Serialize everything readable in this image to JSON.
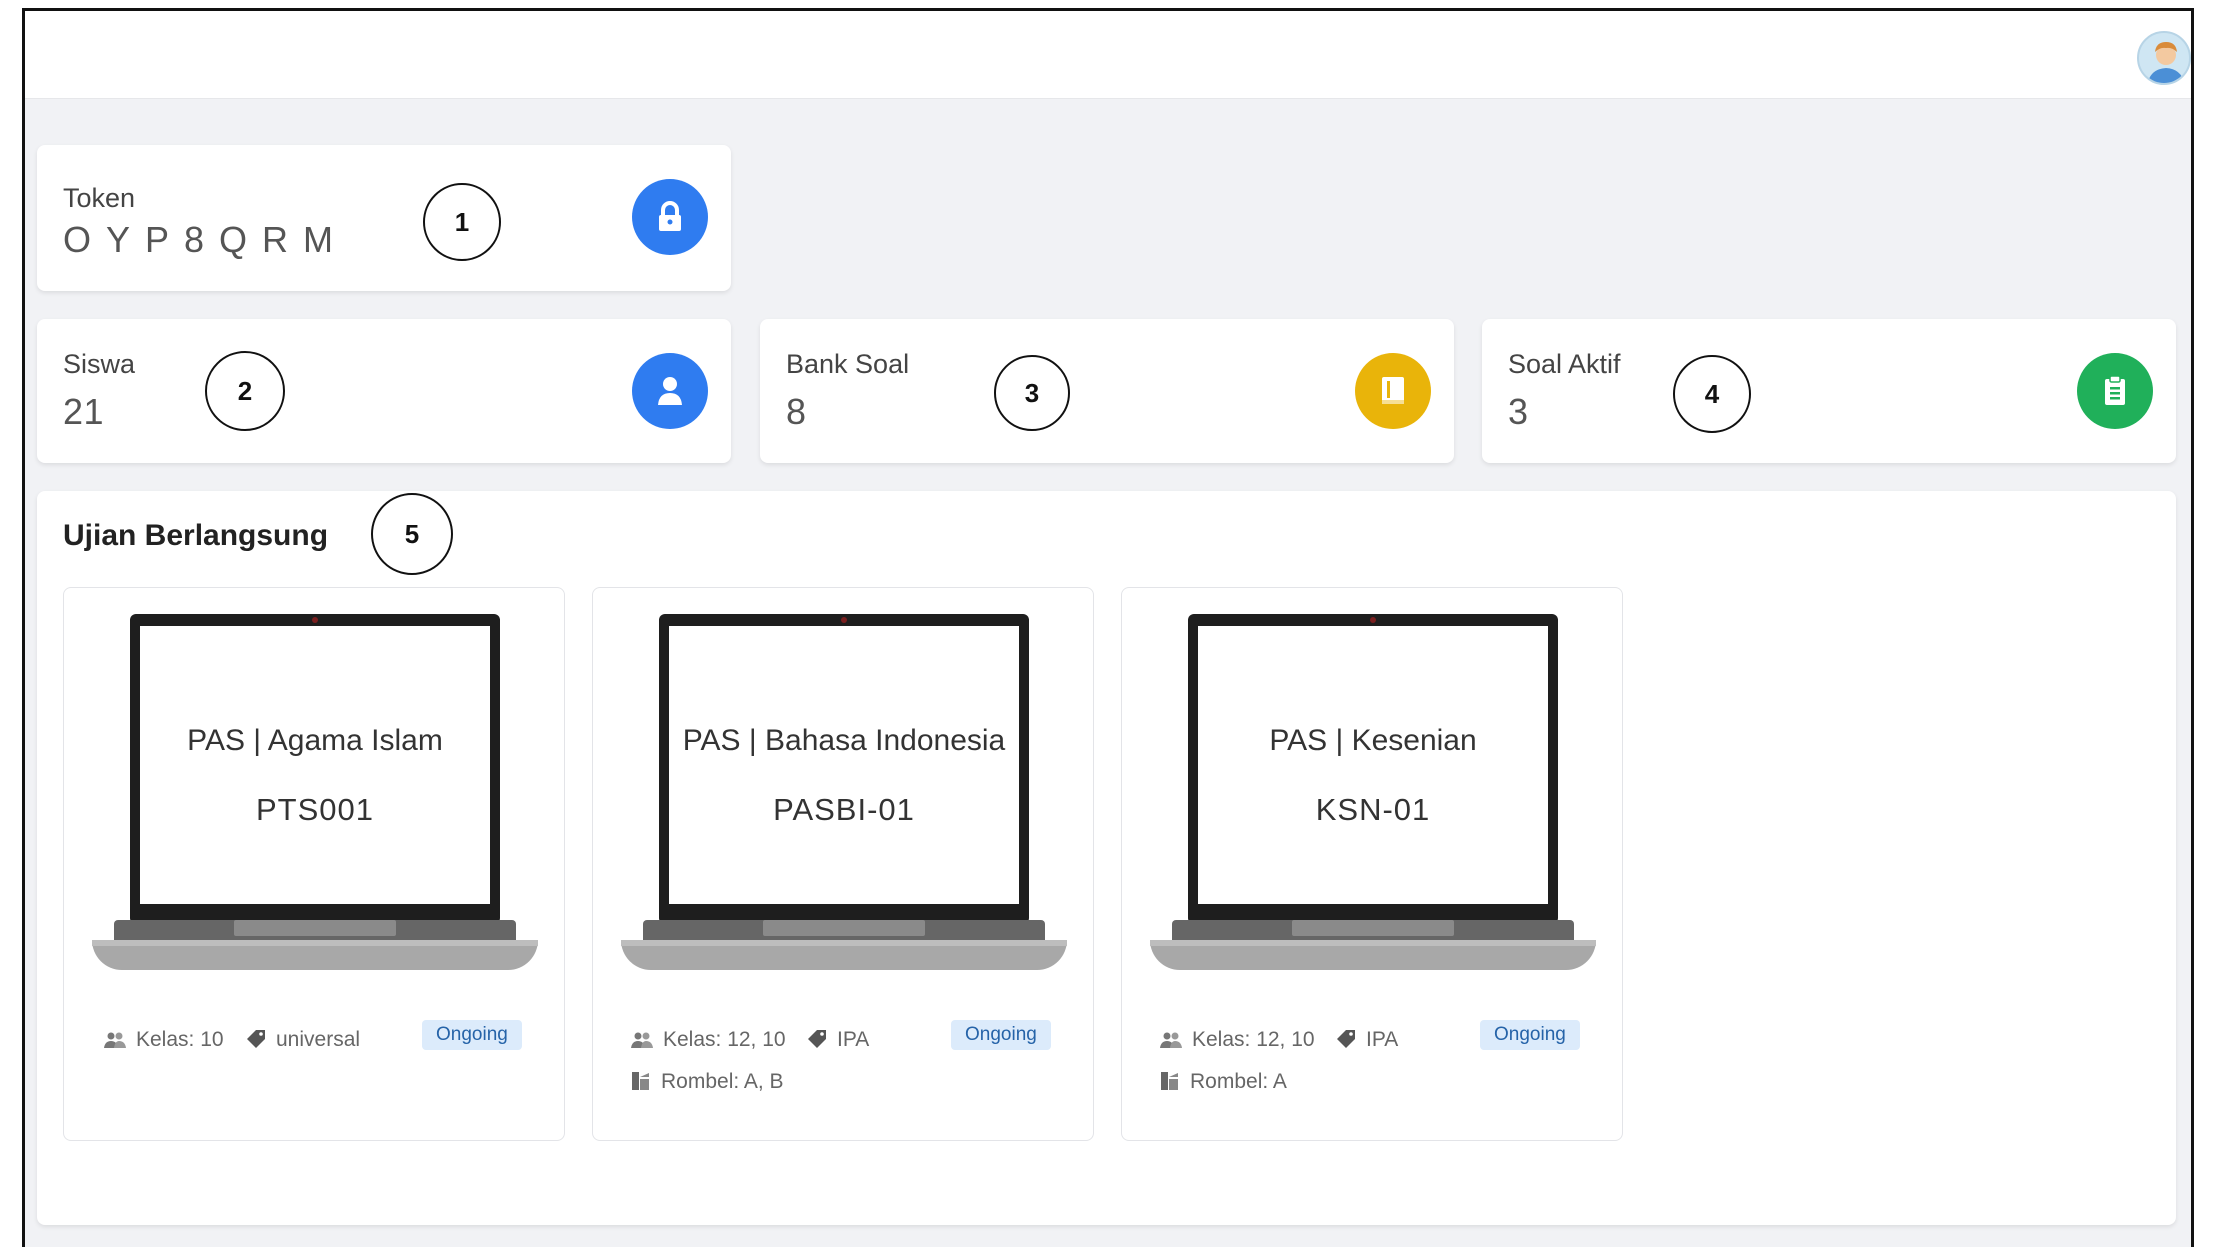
{
  "stats": {
    "token": {
      "label": "Token",
      "value": "OYP8QRM",
      "icon": "lock-icon",
      "color": "#2f7cf0",
      "marker": "1"
    },
    "siswa": {
      "label": "Siswa",
      "value": "21",
      "icon": "user-icon",
      "color": "#2f7cf0",
      "marker": "2"
    },
    "bank_soal": {
      "label": "Bank Soal",
      "value": "8",
      "icon": "book-icon",
      "color": "#e9b40a",
      "marker": "3"
    },
    "soal_aktif": {
      "label": "Soal Aktif",
      "value": "3",
      "icon": "clipboard-icon",
      "color": "#20b05a",
      "marker": "4"
    }
  },
  "ongoing": {
    "title": "Ujian Berlangsung",
    "marker": "5",
    "exams": [
      {
        "name": "PAS | Agama Islam",
        "code": "PTS001",
        "kelas": "Kelas: 10",
        "tag": "universal",
        "rombel": "",
        "status": "Ongoing"
      },
      {
        "name": "PAS | Bahasa Indonesia",
        "code": "PASBI-01",
        "kelas": "Kelas: 12, 10",
        "tag": "IPA",
        "rombel": "Rombel: A, B",
        "status": "Ongoing"
      },
      {
        "name": "PAS | Kesenian",
        "code": "KSN-01",
        "kelas": "Kelas: 12, 10",
        "tag": "IPA",
        "rombel": "Rombel: A",
        "status": "Ongoing"
      }
    ]
  }
}
